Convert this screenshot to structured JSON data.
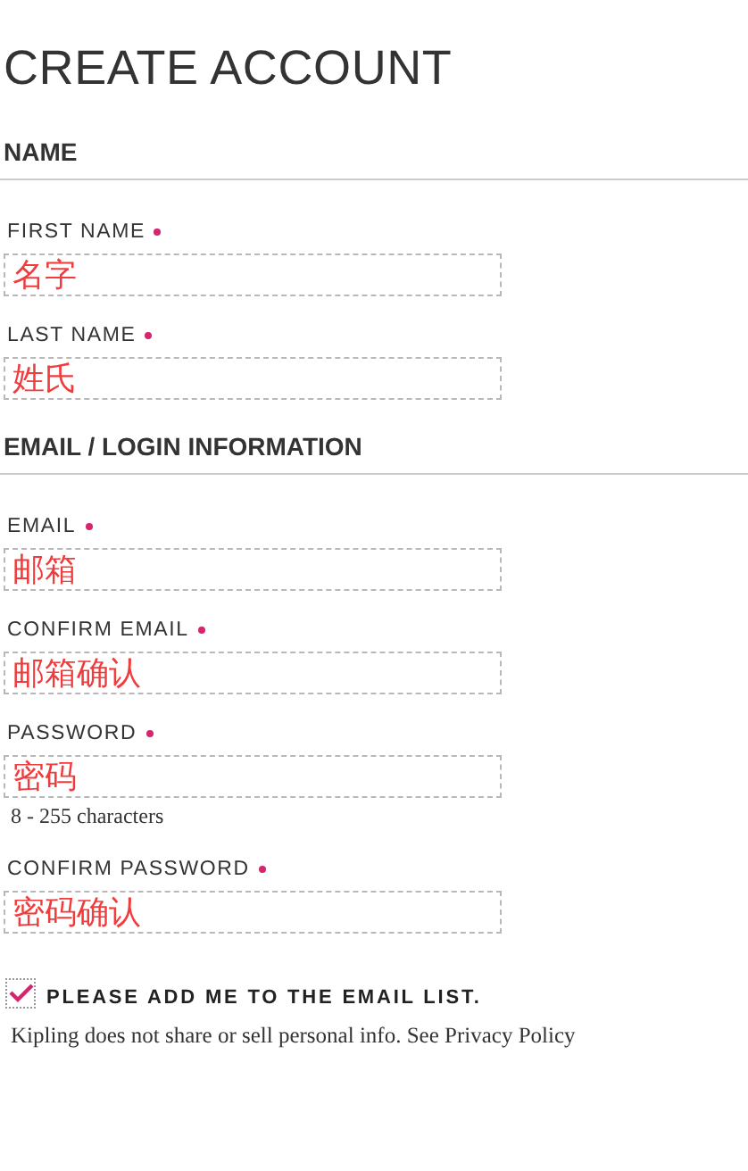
{
  "title": "CREATE ACCOUNT",
  "sections": [
    {
      "heading": "NAME",
      "fields": [
        {
          "label": "FIRST NAME",
          "required": true,
          "value": "名字"
        },
        {
          "label": "LAST NAME",
          "required": true,
          "value": "姓氏"
        }
      ]
    },
    {
      "heading": "EMAIL / LOGIN INFORMATION",
      "fields": [
        {
          "label": "EMAIL",
          "required": true,
          "value": "邮箱"
        },
        {
          "label": "CONFIRM EMAIL",
          "required": true,
          "value": "邮箱确认"
        },
        {
          "label": "PASSWORD",
          "required": true,
          "value": "密码",
          "hint": "8 - 255 characters"
        },
        {
          "label": "CONFIRM PASSWORD",
          "required": true,
          "value": "密码确认"
        }
      ]
    }
  ],
  "checkbox": {
    "label": "PLEASE ADD ME TO THE EMAIL LIST.",
    "checked": true
  },
  "note": "Kipling does not share or sell personal info. See Privacy Policy"
}
